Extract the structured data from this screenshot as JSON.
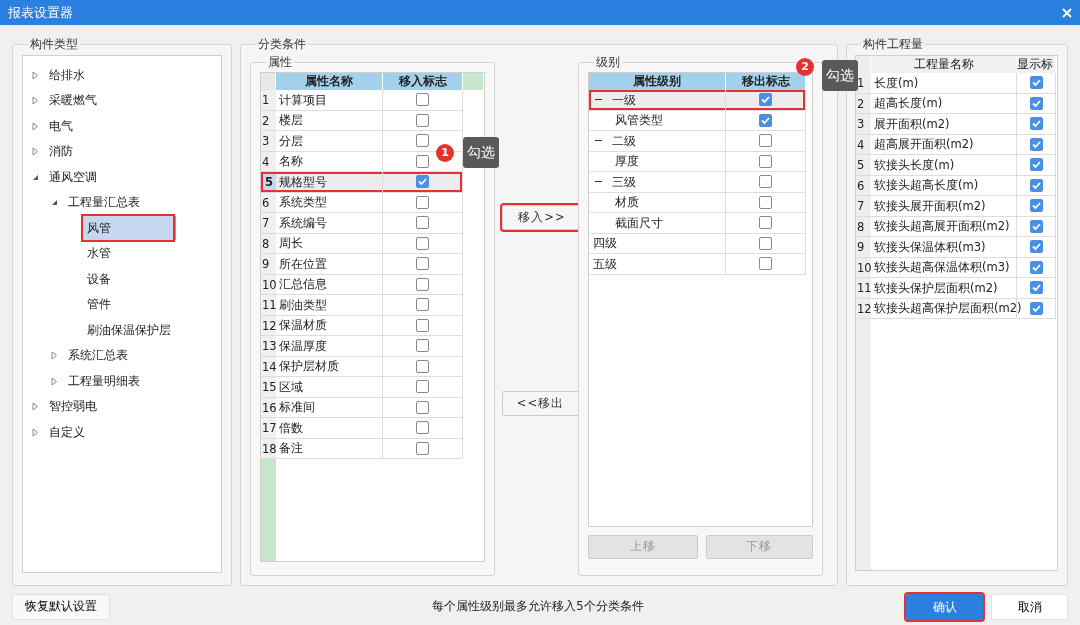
{
  "window": {
    "title": "报表设置器"
  },
  "component_types": {
    "legend": "构件类型",
    "tree": [
      {
        "label": "给排水",
        "expanded": false,
        "selected": false,
        "highlighted": false
      },
      {
        "label": "采暖燃气",
        "expanded": false,
        "selected": false,
        "highlighted": false
      },
      {
        "label": "电气",
        "expanded": false,
        "selected": false,
        "highlighted": false
      },
      {
        "label": "消防",
        "expanded": false,
        "selected": false,
        "highlighted": false
      },
      {
        "label": "通风空调",
        "expanded": true,
        "selected": false,
        "highlighted": false,
        "children": [
          {
            "label": "工程量汇总表",
            "expanded": true,
            "selected": false,
            "highlighted": false,
            "children": [
              {
                "label": "风管",
                "selected": true,
                "highlighted": true
              },
              {
                "label": "水管",
                "selected": false,
                "highlighted": false
              },
              {
                "label": "设备",
                "selected": false,
                "highlighted": false
              },
              {
                "label": "管件",
                "selected": false,
                "highlighted": false
              },
              {
                "label": "刷油保温保护层",
                "selected": false,
                "highlighted": false
              }
            ]
          },
          {
            "label": "系统汇总表",
            "expanded": false,
            "selected": false,
            "highlighted": false
          },
          {
            "label": "工程量明细表",
            "expanded": false,
            "selected": false,
            "highlighted": false
          }
        ]
      },
      {
        "label": "智控弱电",
        "expanded": false,
        "selected": false,
        "highlighted": false
      },
      {
        "label": "自定义",
        "expanded": false,
        "selected": false,
        "highlighted": false
      }
    ]
  },
  "classification": {
    "legend": "分类条件",
    "attributes": {
      "legend": "属性",
      "columns": [
        "属性名称",
        "移入标志"
      ],
      "rows": [
        {
          "number": "1",
          "name": "计算项目",
          "checked": false,
          "selected": false,
          "highlighted": false
        },
        {
          "number": "2",
          "name": "楼层",
          "checked": false,
          "selected": false,
          "highlighted": false
        },
        {
          "number": "3",
          "name": "分层",
          "checked": false,
          "selected": false,
          "highlighted": false
        },
        {
          "number": "4",
          "name": "名称",
          "checked": false,
          "selected": false,
          "highlighted": false
        },
        {
          "number": "5",
          "name": "规格型号",
          "checked": true,
          "selected": true,
          "highlighted": true
        },
        {
          "number": "6",
          "name": "系统类型",
          "checked": false,
          "selected": false,
          "highlighted": false
        },
        {
          "number": "7",
          "name": "系统编号",
          "checked": false,
          "selected": false,
          "highlighted": false
        },
        {
          "number": "8",
          "name": "周长",
          "checked": false,
          "selected": false,
          "highlighted": false
        },
        {
          "number": "9",
          "name": "所在位置",
          "checked": false,
          "selected": false,
          "highlighted": false
        },
        {
          "number": "10",
          "name": "汇总信息",
          "checked": false,
          "selected": false,
          "highlighted": false
        },
        {
          "number": "11",
          "name": "刷油类型",
          "checked": false,
          "selected": false,
          "highlighted": false
        },
        {
          "number": "12",
          "name": "保温材质",
          "checked": false,
          "selected": false,
          "highlighted": false
        },
        {
          "number": "13",
          "name": "保温厚度",
          "checked": false,
          "selected": false,
          "highlighted": false
        },
        {
          "number": "14",
          "name": "保护层材质",
          "checked": false,
          "selected": false,
          "highlighted": false
        },
        {
          "number": "15",
          "name": "区域",
          "checked": false,
          "selected": false,
          "highlighted": false
        },
        {
          "number": "16",
          "name": "标准间",
          "checked": false,
          "selected": false,
          "highlighted": false
        },
        {
          "number": "17",
          "name": "倍数",
          "checked": false,
          "selected": false,
          "highlighted": false
        },
        {
          "number": "18",
          "name": "备注",
          "checked": false,
          "selected": false,
          "highlighted": false
        }
      ]
    },
    "move_in_button": {
      "label": "移入>>",
      "highlighted": true
    },
    "move_out_button": {
      "label": "<<移出",
      "highlighted": false
    },
    "levels": {
      "legend": "级别",
      "columns": [
        "属性级别",
        "移出标志"
      ],
      "tree": [
        {
          "label": "一级",
          "expanded": true,
          "checked": true,
          "selected": true,
          "highlighted": true,
          "children": [
            {
              "label": "风管类型",
              "checked": true,
              "selected": false,
              "highlighted": false
            }
          ]
        },
        {
          "label": "二级",
          "expanded": true,
          "checked": false,
          "selected": false,
          "highlighted": false,
          "children": [
            {
              "label": "厚度",
              "checked": false,
              "selected": false,
              "highlighted": false
            }
          ]
        },
        {
          "label": "三级",
          "expanded": true,
          "checked": false,
          "selected": false,
          "highlighted": false,
          "children": [
            {
              "label": "材质",
              "checked": false,
              "selected": false,
              "highlighted": false
            },
            {
              "label": "截面尺寸",
              "checked": false,
              "selected": false,
              "highlighted": false
            }
          ]
        },
        {
          "label": "四级",
          "checked": false,
          "selected": false,
          "highlighted": false
        },
        {
          "label": "五级",
          "checked": false,
          "selected": false,
          "highlighted": false
        }
      ]
    },
    "move_up_button": {
      "label": "上移",
      "disabled": true
    },
    "move_down_button": {
      "label": "下移",
      "disabled": true
    }
  },
  "quantities": {
    "legend": "构件工程量",
    "columns": [
      "工程量名称",
      "显示标"
    ],
    "rows": [
      {
        "number": "1",
        "name": "长度(m)",
        "checked": true
      },
      {
        "number": "2",
        "name": "超高长度(m)",
        "checked": true
      },
      {
        "number": "3",
        "name": "展开面积(m2)",
        "checked": true
      },
      {
        "number": "4",
        "name": "超高展开面积(m2)",
        "checked": true
      },
      {
        "number": "5",
        "name": "软接头长度(m)",
        "checked": true
      },
      {
        "number": "6",
        "name": "软接头超高长度(m)",
        "checked": true
      },
      {
        "number": "7",
        "name": "软接头展开面积(m2)",
        "checked": true
      },
      {
        "number": "8",
        "name": "软接头超高展开面积(m2)",
        "checked": true
      },
      {
        "number": "9",
        "name": "软接头保温体积(m3)",
        "checked": true
      },
      {
        "number": "10",
        "name": "软接头超高保温体积(m3)",
        "checked": true
      },
      {
        "number": "11",
        "name": "软接头保护层面积(m2)",
        "checked": true
      },
      {
        "number": "12",
        "name": "软接头超高保护层面积(m2)",
        "checked": true
      }
    ]
  },
  "callouts": [
    {
      "number": "1",
      "text": "勾选"
    },
    {
      "number": "2",
      "text": "勾选"
    }
  ],
  "footer": {
    "restore_button": "恢复默认设置",
    "message": "每个属性级别最多允许移入5个分类条件",
    "confirm_button": {
      "label": "确认",
      "highlighted": true
    },
    "cancel_button": {
      "label": "取消",
      "highlighted": false
    }
  }
}
